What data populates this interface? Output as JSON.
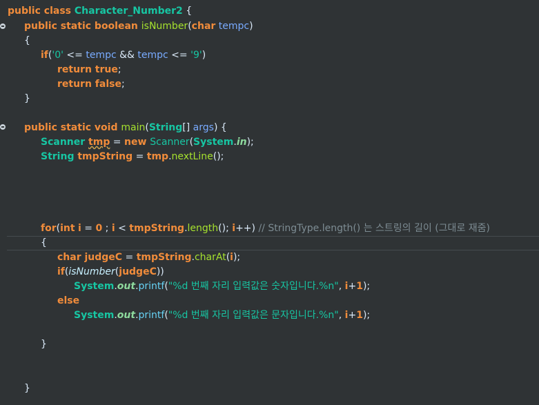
{
  "code": {
    "line1": {
      "kw": "public class ",
      "name": "Character_Number2",
      "rest": " {"
    },
    "line2": {
      "kw": "public static boolean ",
      "name": "isNumber",
      "p1": "(",
      "ty": "char",
      "sp": " ",
      "arg": "tempc",
      "p2": ")"
    },
    "line3": "{",
    "line4": {
      "kw": "if",
      "a": "(",
      "s1": "'0'",
      "b": " <= ",
      "v1": "tempc",
      "c": " && ",
      "v2": "tempc",
      "d": " <= ",
      "s2": "'9'",
      "e": ")"
    },
    "line5": {
      "kw": "return true",
      "semi": ";"
    },
    "line6": {
      "kw": "return false",
      "semi": ";"
    },
    "line7": "}",
    "line8": {
      "kw": "public static void ",
      "name": "main",
      "a": "(",
      "ty": "String",
      "b": "[] ",
      "arg": "args",
      "c": ") {"
    },
    "line9": {
      "ty": "Scanner ",
      "var": "tmp",
      "a": " = ",
      "kw": "new ",
      "cls": "Scanner",
      "b": "(",
      "sys": "System",
      "dot": ".",
      "fld": "in",
      "c": ");"
    },
    "line10": {
      "ty": "String ",
      "var": "tmpString",
      "a": " = ",
      "obj": "tmp",
      "dot": ".",
      "method": "nextLine",
      "c": "();"
    },
    "line11": {
      "kw": "for",
      "a": "(",
      "ty": "int",
      "b": " ",
      "i1": "i",
      "c": " = ",
      "n0": "0",
      "d": " ; ",
      "i2": "i",
      "e": " < ",
      "obj": "tmpString",
      "dot": ".",
      "method": "length",
      "f": "(); ",
      "i3": "i",
      "g": "++) ",
      "comment": "// StringType.length() 는 스트링의 길이 (그대로 재줌)"
    },
    "line12": "{",
    "line13": {
      "ty": "char ",
      "var": "judgeC",
      "a": " = ",
      "obj": "tmpString",
      "dot": ".",
      "method": "charAt",
      "b": "(",
      "i": "i",
      "c": ");"
    },
    "line14": {
      "kw": "if",
      "a": "(",
      "call": "isNumber",
      "b": "(",
      "arg": "judgeC",
      "c": "))"
    },
    "line15": {
      "sys": "System",
      "dot": ".",
      "fld": "out",
      "dot2": ".",
      "method": "printf",
      "a": "(",
      "str": "\"%d 번째 자리 입력값은 숫자입니다.%n\"",
      "b": ", ",
      "i": "i",
      "plus": "+",
      "one": "1",
      "c": ");"
    },
    "line16": {
      "kw": "else"
    },
    "line17": {
      "sys": "System",
      "dot": ".",
      "fld": "out",
      "dot2": ".",
      "method": "printf",
      "a": "(",
      "str": "\"%d 번째 자리 입력값은 문자입니다.%n\"",
      "b": ", ",
      "i": "i",
      "plus": "+",
      "one": "1",
      "c": ");"
    },
    "line18": "}",
    "line19": "}"
  }
}
